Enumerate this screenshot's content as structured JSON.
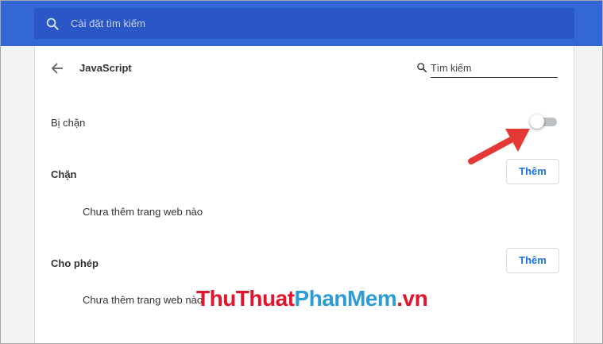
{
  "top_search": {
    "placeholder": "Cài đặt tìm kiếm"
  },
  "header": {
    "title": "JavaScript"
  },
  "page_search": {
    "placeholder": "Tìm kiếm"
  },
  "toggle": {
    "label": "Bị chặn",
    "enabled": false
  },
  "block_section": {
    "title": "Chặn",
    "add_label": "Thêm",
    "empty_text": "Chưa thêm trang web nào"
  },
  "allow_section": {
    "title": "Cho phép",
    "add_label": "Thêm",
    "empty_text": "Chưa thêm trang web nào"
  },
  "watermark": {
    "part1": "ThuThuat",
    "part2": "PhanMem",
    "part3": ".vn"
  },
  "colors": {
    "header_blue": "#3367d6",
    "search_bar_blue": "#2a56c6",
    "link_blue": "#1a73e8",
    "annotation_red": "#e53935"
  }
}
